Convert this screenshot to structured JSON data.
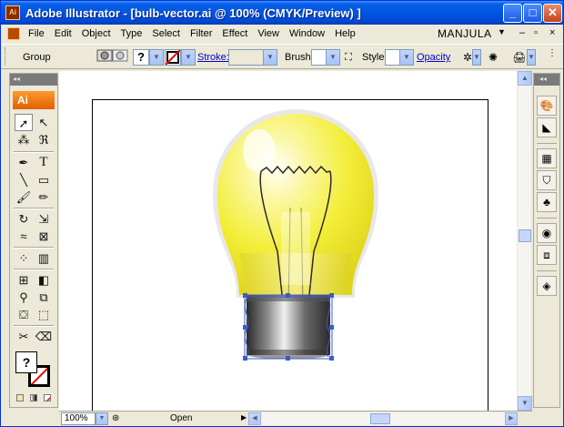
{
  "window": {
    "title": "Adobe Illustrator - [bulb-vector.ai @ 100% (CMYK/Preview) ]",
    "app_icon_label": "Ai",
    "buttons": {
      "minimize": "_",
      "maximize": "□",
      "close": "✕"
    }
  },
  "menubar": {
    "items": [
      "File",
      "Edit",
      "Object",
      "Type",
      "Select",
      "Filter",
      "Effect",
      "View",
      "Window",
      "Help"
    ],
    "workspace": "MANJULA",
    "workspace_arrow": "▼",
    "doc_controls": [
      "–",
      "▫",
      "×"
    ]
  },
  "controlbar": {
    "selection": "Group",
    "stroke_label": "Stroke:",
    "brush_label": "Brush:",
    "style_label": "Style:",
    "opacity_label": "Opacity",
    "question_mark": "?"
  },
  "tools": {
    "badge": "Ai",
    "collapse": "◂◂",
    "fill_label": "?"
  },
  "right_panel": {
    "collapse": "◂◂"
  },
  "status": {
    "zoom": "100%",
    "state": "Open",
    "arrow": "▶"
  },
  "colors": {
    "bulb_glass": "#f3ee3a",
    "bulb_highlight": "#fffde0",
    "selection": "#3a5ccc",
    "titlebar": "#0055e5",
    "ai_badge": "#f07a10"
  },
  "icons": [
    "grip-icon",
    "selection-icon",
    "direct-select-icon",
    "magic-wand-icon",
    "lasso-icon",
    "pen-icon",
    "type-icon",
    "line-icon",
    "rectangle-icon",
    "paintbrush-icon",
    "pencil-icon",
    "rotate-icon",
    "scale-icon",
    "warp-icon",
    "free-transform-icon",
    "symbol-sprayer-icon",
    "graph-icon",
    "mesh-icon",
    "gradient-icon",
    "eyedropper-icon",
    "blend-icon",
    "live-paint-icon",
    "live-paint-select-icon",
    "slice-icon",
    "eraser-icon",
    "hand-icon",
    "zoom-icon"
  ]
}
